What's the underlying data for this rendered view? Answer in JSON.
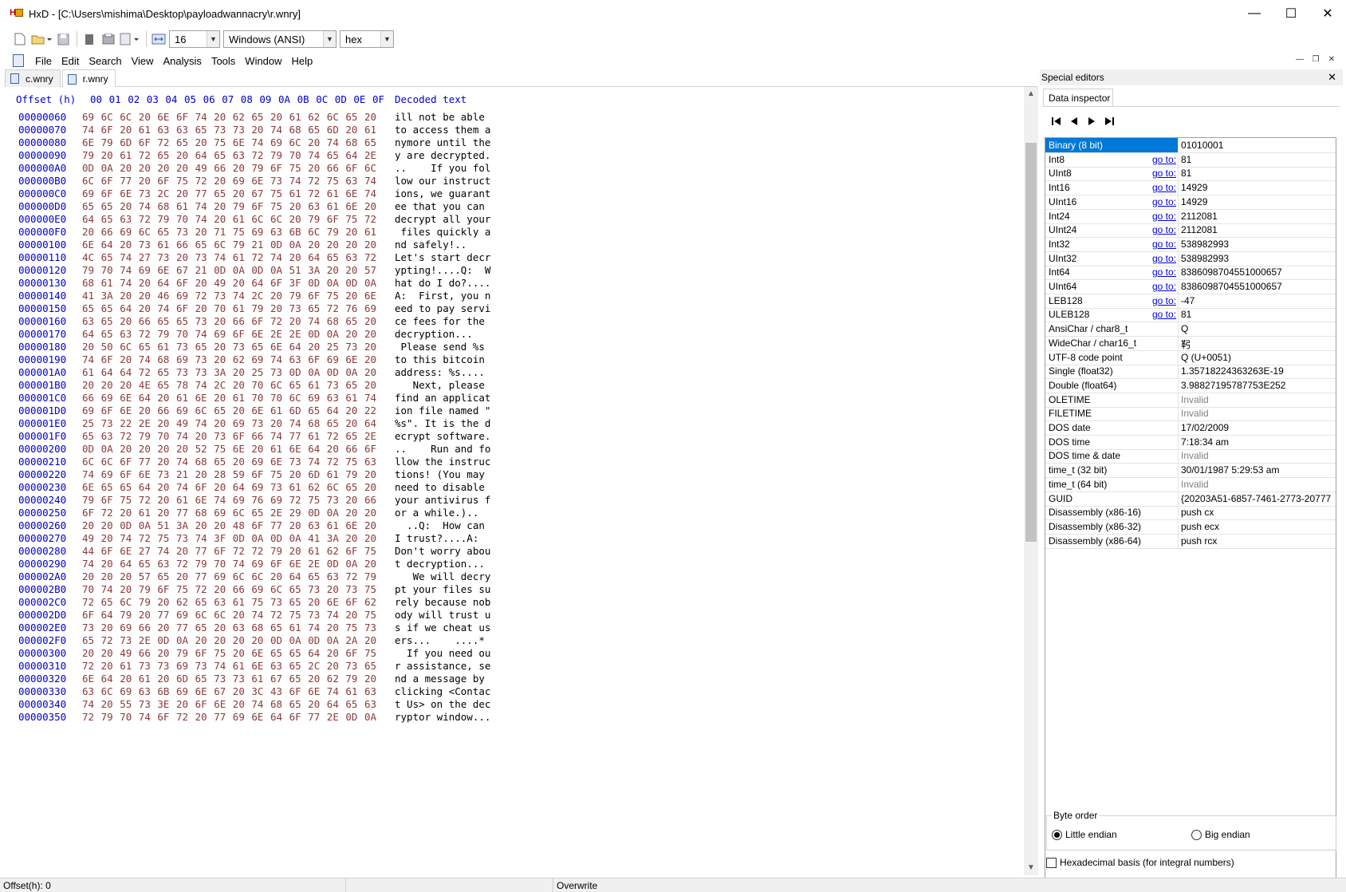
{
  "window": {
    "title": "HxD - [C:\\Users\\mishima\\Desktop\\payloadwannacry\\r.wnry]",
    "minimize": "—",
    "maximize": "☐",
    "close": "✕"
  },
  "toolbar": {
    "bytes_per_row": "16",
    "charset": "Windows (ANSI)",
    "display_mode": "hex",
    "icons": [
      "new-file-icon",
      "open-file-icon",
      "save-icon",
      "print-icon",
      "properties-icon",
      "cut-icon",
      "bytes-per-row-icon"
    ]
  },
  "menu": [
    "File",
    "Edit",
    "Search",
    "View",
    "Analysis",
    "Tools",
    "Window",
    "Help"
  ],
  "tabs": [
    {
      "label": "c.wnry",
      "active": false
    },
    {
      "label": "r.wnry",
      "active": true
    }
  ],
  "hex": {
    "header_offset": "Offset (h)",
    "header_cols": [
      "00",
      "01",
      "02",
      "03",
      "04",
      "05",
      "06",
      "07",
      "08",
      "09",
      "0A",
      "0B",
      "0C",
      "0D",
      "0E",
      "0F"
    ],
    "header_decoded": "Decoded text",
    "rows": [
      {
        "offset": "00000060",
        "bytes": "69 6C 6C 20 6E 6F 74 20 62 65 20 61 62 6C 65 20",
        "text": "ill not be able "
      },
      {
        "offset": "00000070",
        "bytes": "74 6F 20 61 63 63 65 73 73 20 74 68 65 6D 20 61",
        "text": "to access them a"
      },
      {
        "offset": "00000080",
        "bytes": "6E 79 6D 6F 72 65 20 75 6E 74 69 6C 20 74 68 65",
        "text": "nymore until the"
      },
      {
        "offset": "00000090",
        "bytes": "79 20 61 72 65 20 64 65 63 72 79 70 74 65 64 2E",
        "text": "y are decrypted."
      },
      {
        "offset": "000000A0",
        "bytes": "0D 0A 20 20 20 20 49 66 20 79 6F 75 20 66 6F 6C",
        "text": "..    If you fol"
      },
      {
        "offset": "000000B0",
        "bytes": "6C 6F 77 20 6F 75 72 20 69 6E 73 74 72 75 63 74",
        "text": "low our instruct"
      },
      {
        "offset": "000000C0",
        "bytes": "69 6F 6E 73 2C 20 77 65 20 67 75 61 72 61 6E 74",
        "text": "ions, we guarant"
      },
      {
        "offset": "000000D0",
        "bytes": "65 65 20 74 68 61 74 20 79 6F 75 20 63 61 6E 20",
        "text": "ee that you can "
      },
      {
        "offset": "000000E0",
        "bytes": "64 65 63 72 79 70 74 20 61 6C 6C 20 79 6F 75 72",
        "text": "decrypt all your"
      },
      {
        "offset": "000000F0",
        "bytes": "20 66 69 6C 65 73 20 71 75 69 63 6B 6C 79 20 61",
        "text": " files quickly a"
      },
      {
        "offset": "00000100",
        "bytes": "6E 64 20 73 61 66 65 6C 79 21 0D 0A 20 20 20 20",
        "text": "nd safely!..    "
      },
      {
        "offset": "00000110",
        "bytes": "4C 65 74 27 73 20 73 74 61 72 74 20 64 65 63 72",
        "text": "Let's start decr"
      },
      {
        "offset": "00000120",
        "bytes": "79 70 74 69 6E 67 21 0D 0A 0D 0A 51 3A 20 20 57",
        "text": "ypting!....Q:  W"
      },
      {
        "offset": "00000130",
        "bytes": "68 61 74 20 64 6F 20 49 20 64 6F 3F 0D 0A 0D 0A",
        "text": "hat do I do?...."
      },
      {
        "offset": "00000140",
        "bytes": "41 3A 20 20 46 69 72 73 74 2C 20 79 6F 75 20 6E",
        "text": "A:  First, you n"
      },
      {
        "offset": "00000150",
        "bytes": "65 65 64 20 74 6F 20 70 61 79 20 73 65 72 76 69",
        "text": "eed to pay servi"
      },
      {
        "offset": "00000160",
        "bytes": "63 65 20 66 65 65 73 20 66 6F 72 20 74 68 65 20",
        "text": "ce fees for the "
      },
      {
        "offset": "00000170",
        "bytes": "64 65 63 72 79 70 74 69 6F 6E 2E 2E 0D 0A 20 20",
        "text": "decryption...   "
      },
      {
        "offset": "00000180",
        "bytes": "20 50 6C 65 61 73 65 20 73 65 6E 64 20 25 73 20",
        "text": " Please send %s "
      },
      {
        "offset": "00000190",
        "bytes": "74 6F 20 74 68 69 73 20 62 69 74 63 6F 69 6E 20",
        "text": "to this bitcoin "
      },
      {
        "offset": "000001A0",
        "bytes": "61 64 64 72 65 73 73 3A 20 25 73 0D 0A 0D 0A 20",
        "text": "address: %s.... "
      },
      {
        "offset": "000001B0",
        "bytes": "20 20 20 4E 65 78 74 2C 20 70 6C 65 61 73 65 20",
        "text": "   Next, please "
      },
      {
        "offset": "000001C0",
        "bytes": "66 69 6E 64 20 61 6E 20 61 70 70 6C 69 63 61 74",
        "text": "find an applicat"
      },
      {
        "offset": "000001D0",
        "bytes": "69 6F 6E 20 66 69 6C 65 20 6E 61 6D 65 64 20 22",
        "text": "ion file named \""
      },
      {
        "offset": "000001E0",
        "bytes": "25 73 22 2E 20 49 74 20 69 73 20 74 68 65 20 64",
        "text": "%s\". It is the d"
      },
      {
        "offset": "000001F0",
        "bytes": "65 63 72 79 70 74 20 73 6F 66 74 77 61 72 65 2E",
        "text": "ecrypt software."
      },
      {
        "offset": "00000200",
        "bytes": "0D 0A 20 20 20 20 52 75 6E 20 61 6E 64 20 66 6F",
        "text": "..    Run and fo"
      },
      {
        "offset": "00000210",
        "bytes": "6C 6C 6F 77 20 74 68 65 20 69 6E 73 74 72 75 63",
        "text": "llow the instruc"
      },
      {
        "offset": "00000220",
        "bytes": "74 69 6F 6E 73 21 20 28 59 6F 75 20 6D 61 79 20",
        "text": "tions! (You may "
      },
      {
        "offset": "00000230",
        "bytes": "6E 65 65 64 20 74 6F 20 64 69 73 61 62 6C 65 20",
        "text": "need to disable "
      },
      {
        "offset": "00000240",
        "bytes": "79 6F 75 72 20 61 6E 74 69 76 69 72 75 73 20 66",
        "text": "your antivirus f"
      },
      {
        "offset": "00000250",
        "bytes": "6F 72 20 61 20 77 68 69 6C 65 2E 29 0D 0A 20 20",
        "text": "or a while.)..  "
      },
      {
        "offset": "00000260",
        "bytes": "20 20 0D 0A 51 3A 20 20 48 6F 77 20 63 61 6E 20",
        "text": "  ..Q:  How can "
      },
      {
        "offset": "00000270",
        "bytes": "49 20 74 72 75 73 74 3F 0D 0A 0D 0A 41 3A 20 20",
        "text": "I trust?....A:  "
      },
      {
        "offset": "00000280",
        "bytes": "44 6F 6E 27 74 20 77 6F 72 72 79 20 61 62 6F 75",
        "text": "Don't worry abou"
      },
      {
        "offset": "00000290",
        "bytes": "74 20 64 65 63 72 79 70 74 69 6F 6E 2E 0D 0A 20",
        "text": "t decryption... "
      },
      {
        "offset": "000002A0",
        "bytes": "20 20 20 57 65 20 77 69 6C 6C 20 64 65 63 72 79",
        "text": "   We will decry"
      },
      {
        "offset": "000002B0",
        "bytes": "70 74 20 79 6F 75 72 20 66 69 6C 65 73 20 73 75",
        "text": "pt your files su"
      },
      {
        "offset": "000002C0",
        "bytes": "72 65 6C 79 20 62 65 63 61 75 73 65 20 6E 6F 62",
        "text": "rely because nob"
      },
      {
        "offset": "000002D0",
        "bytes": "6F 64 79 20 77 69 6C 6C 20 74 72 75 73 74 20 75",
        "text": "ody will trust u"
      },
      {
        "offset": "000002E0",
        "bytes": "73 20 69 66 20 77 65 20 63 68 65 61 74 20 75 73",
        "text": "s if we cheat us"
      },
      {
        "offset": "000002F0",
        "bytes": "65 72 73 2E 0D 0A 20 20 20 20 0D 0A 0D 0A 2A 20",
        "text": "ers...    ....* "
      },
      {
        "offset": "00000300",
        "bytes": "20 20 49 66 20 79 6F 75 20 6E 65 65 64 20 6F 75",
        "text": "  If you need ou"
      },
      {
        "offset": "00000310",
        "bytes": "72 20 61 73 73 69 73 74 61 6E 63 65 2C 20 73 65",
        "text": "r assistance, se"
      },
      {
        "offset": "00000320",
        "bytes": "6E 64 20 61 20 6D 65 73 73 61 67 65 20 62 79 20",
        "text": "nd a message by "
      },
      {
        "offset": "00000330",
        "bytes": "63 6C 69 63 6B 69 6E 67 20 3C 43 6F 6E 74 61 63",
        "text": "clicking <Contac"
      },
      {
        "offset": "00000340",
        "bytes": "74 20 55 73 3E 20 6F 6E 20 74 68 65 20 64 65 63",
        "text": "t Us> on the dec"
      },
      {
        "offset": "00000350",
        "bytes": "72 79 70 74 6F 72 20 77 69 6E 64 6F 77 2E 0D 0A",
        "text": "ryptor window..."
      }
    ]
  },
  "special_editors": {
    "title": "Special editors",
    "close": "✕",
    "tab": "Data inspector",
    "goto_label": "go to:",
    "rows": [
      {
        "name": "Binary (8 bit)",
        "goto": false,
        "value": "01010001",
        "selected": true
      },
      {
        "name": "Int8",
        "goto": true,
        "value": "81"
      },
      {
        "name": "UInt8",
        "goto": true,
        "value": "81"
      },
      {
        "name": "Int16",
        "goto": true,
        "value": "14929"
      },
      {
        "name": "UInt16",
        "goto": true,
        "value": "14929"
      },
      {
        "name": "Int24",
        "goto": true,
        "value": "2112081"
      },
      {
        "name": "UInt24",
        "goto": true,
        "value": "2112081"
      },
      {
        "name": "Int32",
        "goto": true,
        "value": "538982993"
      },
      {
        "name": "UInt32",
        "goto": true,
        "value": "538982993"
      },
      {
        "name": "Int64",
        "goto": true,
        "value": "8386098704551000657"
      },
      {
        "name": "UInt64",
        "goto": true,
        "value": "8386098704551000657"
      },
      {
        "name": "LEB128",
        "goto": true,
        "value": "-47"
      },
      {
        "name": "ULEB128",
        "goto": true,
        "value": "81"
      },
      {
        "name": "AnsiChar / char8_t",
        "goto": false,
        "value": "Q"
      },
      {
        "name": "WideChar / char16_t",
        "goto": false,
        "value": "䩑"
      },
      {
        "name": "UTF-8 code point",
        "goto": false,
        "value": "Q (U+0051)"
      },
      {
        "name": "Single (float32)",
        "goto": false,
        "value": "1.35718224363263E-19"
      },
      {
        "name": "Double (float64)",
        "goto": false,
        "value": "3.98827195787753E252"
      },
      {
        "name": "OLETIME",
        "goto": false,
        "value": "Invalid",
        "invalid": true
      },
      {
        "name": "FILETIME",
        "goto": false,
        "value": "Invalid",
        "invalid": true
      },
      {
        "name": "DOS date",
        "goto": false,
        "value": "17/02/2009"
      },
      {
        "name": "DOS time",
        "goto": false,
        "value": "7:18:34 am"
      },
      {
        "name": "DOS time & date",
        "goto": false,
        "value": "Invalid",
        "invalid": true
      },
      {
        "name": "time_t (32 bit)",
        "goto": false,
        "value": "30/01/1987 5:29:53 am"
      },
      {
        "name": "time_t (64 bit)",
        "goto": false,
        "value": "Invalid",
        "invalid": true
      },
      {
        "name": "GUID",
        "goto": false,
        "value": "{20203A51-6857-7461-2773-20777"
      },
      {
        "name": "Disassembly (x86-16)",
        "goto": false,
        "value": "push cx"
      },
      {
        "name": "Disassembly (x86-32)",
        "goto": false,
        "value": "push ecx"
      },
      {
        "name": "Disassembly (x86-64)",
        "goto": false,
        "value": "push rcx"
      }
    ],
    "byte_order_label": "Byte order",
    "little_endian": "Little endian",
    "big_endian": "Big endian",
    "little_endian_selected": true,
    "hex_basis_label": "Hexadecimal basis (for integral numbers)"
  },
  "status": {
    "offset": "Offset(h): 0",
    "mode": "Overwrite"
  },
  "colors": {
    "offset_blue": "#0000c8",
    "byte_brown": "#8a3a3a",
    "selection": "#0078d7",
    "link": "#0000ee"
  }
}
